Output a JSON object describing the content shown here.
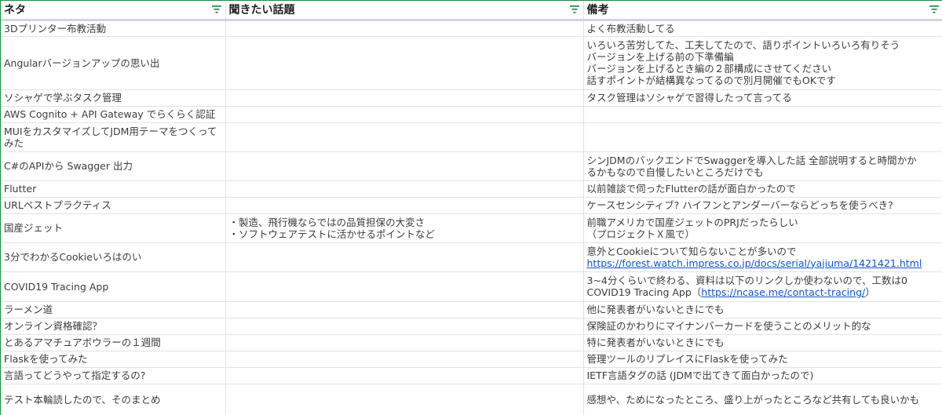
{
  "header": {
    "col1": "ネタ",
    "col2": "聞きたい話題",
    "col3": "備考",
    "filter_icon": "filter-icon"
  },
  "rows": [
    {
      "neta": "3Dプリンター布教活動",
      "topic": [],
      "note": [
        "よく布教活動してる"
      ]
    },
    {
      "neta": "Angularバージョンアップの思い出",
      "topic": [],
      "note": [
        "いろいろ苦労してた、工夫してたので、語りポイントいろいろ有りそう",
        "バージョンを上げる前の下準備編",
        "バージョンを上げるとき編の２部構成にさせてください",
        "話すポイントが結構異なってるので別月開催でもOKです"
      ]
    },
    {
      "neta": "ソシャゲで学ぶタスク管理",
      "topic": [],
      "note": [
        "タスク管理はソシャゲで習得したって言ってる"
      ]
    },
    {
      "neta": "AWS Cognito + API Gateway でらくらく認証",
      "topic": [],
      "note": []
    },
    {
      "neta": "MUIをカスタマイズしてJDM用テーマをつくってみた",
      "topic": [],
      "note": []
    },
    {
      "neta": "C#のAPIから Swagger 出力",
      "topic": [],
      "note": [
        "シンJDMのバックエンドでSwaggerを導入した話 全部説明すると時間かか",
        "るかもなので自慢したいところだけでも"
      ]
    },
    {
      "neta": "Flutter",
      "topic": [],
      "note": [
        "以前雑談で伺ったFlutterの話が面白かったので"
      ]
    },
    {
      "neta": "URLベストプラクティス",
      "topic": [],
      "note": [
        "ケースセンシティブ? ハイフンとアンダーバーならどっちを使うべき?"
      ]
    },
    {
      "neta": "国産ジェット",
      "topic": [
        "・製造、飛行機ならではの品質担保の大変さ",
        "・ソフトウェアテストに活かせるポイントなど"
      ],
      "note": [
        "前職アメリカで国産ジェットのPRJだったらしい",
        "（プロジェクトＸ風で）"
      ]
    },
    {
      "neta": "3分でわかるCookieいろはのい",
      "topic": [],
      "note": [
        "意外とCookieについて知らないことが多いので"
      ],
      "note_link": "https://forest.watch.impress.co.jp/docs/serial/yajiuma/1421421.html"
    },
    {
      "neta": "COVID19 Tracing App",
      "topic": [],
      "note": [
        "3~4分くらいで終わる、資料は以下のリンクしか使わないので、工数は0"
      ],
      "note_prefix": "COVID19 Tracing App（",
      "note_link": "https://ncase.me/contact-tracing/",
      "note_suffix": "）"
    },
    {
      "neta": "ラーメン道",
      "topic": [],
      "note": [
        "他に発表者がいないときにでも"
      ]
    },
    {
      "neta": "オンライン資格確認？",
      "topic": [],
      "note": [
        "保険証のかわりにマイナンバーカードを使うことのメリット的な"
      ]
    },
    {
      "neta": "とあるアマチュアボウラーの１週間",
      "topic": [],
      "note": [
        "特に発表者がいないときにでも"
      ]
    },
    {
      "neta": "Flaskを使ってみた",
      "topic": [],
      "note": [
        "管理ツールのリプレイスにFlaskを使ってみた"
      ]
    },
    {
      "neta": "言語ってどうやって指定するの?",
      "topic": [],
      "note": [
        "IETF言語タグの話 (JDMで出てきて面白かったので)"
      ]
    },
    {
      "neta": "テスト本輪読したので、そのまとめ",
      "topic": [],
      "note": [
        "感想や、ためになったところ、盛り上がったところなど共有しても良いかも"
      ]
    }
  ],
  "colors": {
    "frame": "#1e8e3e",
    "grid": "#e2e2e2",
    "header_rule": "#cfd6df",
    "link": "#1155cc",
    "filter": "#188038"
  }
}
